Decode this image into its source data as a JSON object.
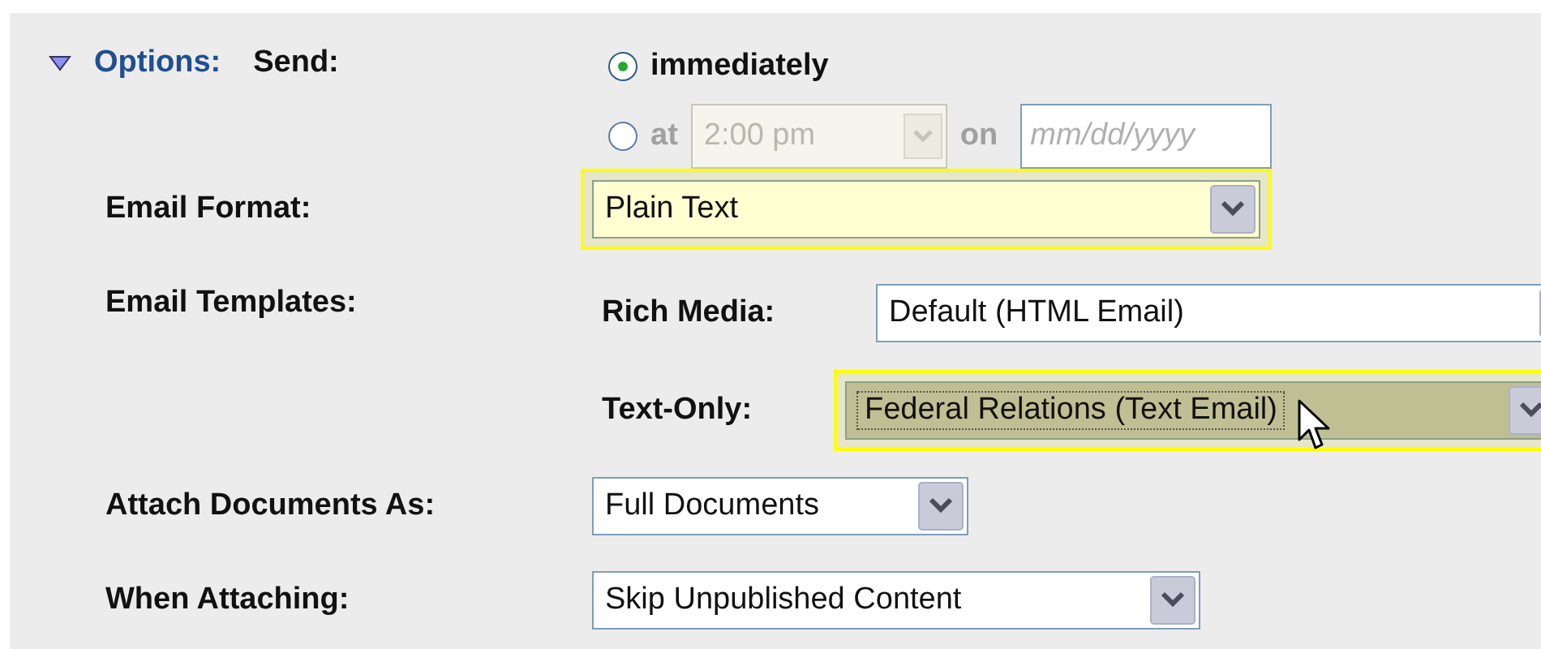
{
  "section": {
    "title": "Options:",
    "expanded": true
  },
  "send": {
    "label": "Send:",
    "options": [
      {
        "kind": "plain",
        "label": "immediately",
        "selected": true,
        "disabled": false
      },
      {
        "kind": "schedule",
        "label": "at",
        "selected": false,
        "disabled": true,
        "time": "2:00 pm",
        "joiner": "on",
        "date_placeholder": "mm/dd/yyyy"
      }
    ]
  },
  "fields": [
    {
      "kind": "select",
      "label": "Email Format:",
      "value": "Plain Text",
      "highlighted": true,
      "focused": false
    },
    {
      "kind": "group",
      "label": "Email Templates:",
      "items": [
        {
          "label": "Rich Media:",
          "value": "Default (HTML Email)",
          "highlighted": false,
          "focused": false
        },
        {
          "label": "Text-Only:",
          "value": "Federal Relations (Text Email)",
          "highlighted": true,
          "focused": true
        }
      ]
    },
    {
      "kind": "select",
      "label": "Attach Documents As:",
      "value": "Full Documents",
      "highlighted": false,
      "focused": false
    },
    {
      "kind": "select",
      "label": "When Attaching:",
      "value": "Skip Unpublished Content",
      "highlighted": false,
      "focused": false
    }
  ]
}
